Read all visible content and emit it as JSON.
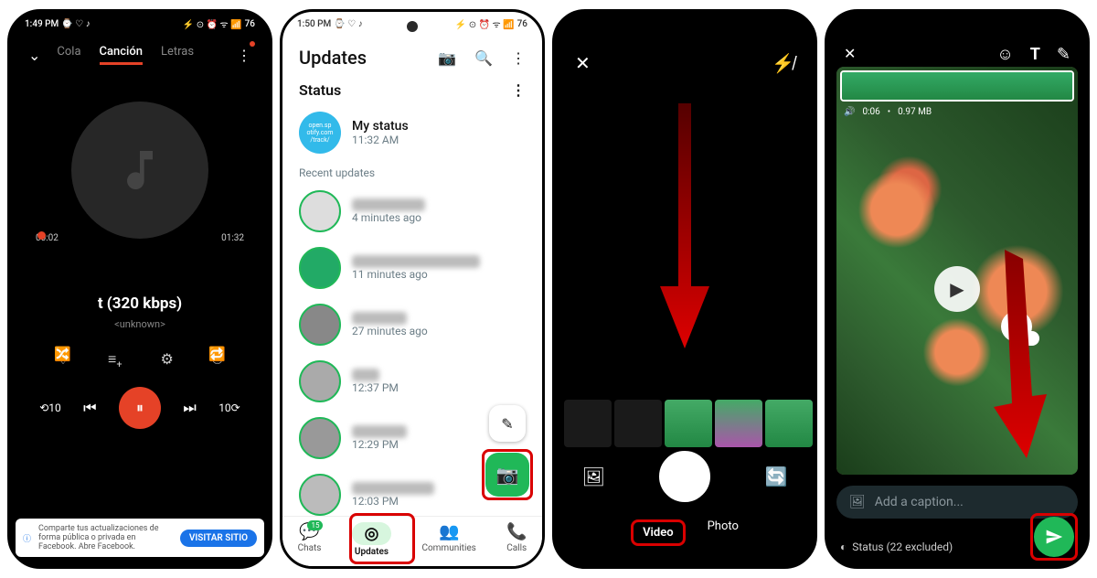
{
  "status": {
    "time1": "1:49 PM",
    "time2": "1:50 PM",
    "icons_left": "⌚ ♡ ♪ ♪",
    "icons_right": "⚡ ⊙ ⏰ ᯤ ▦ 📶",
    "battery": "76"
  },
  "phone1": {
    "tabs": {
      "queue": "Cola",
      "song": "Canción",
      "lyrics": "Letras"
    },
    "time_cur": "00:02",
    "time_total": "01:32",
    "title": "t (320 kbps)",
    "subtitle": "<unknown>",
    "banner_text": "Comparte tus actualizaciones de forma pública o privada en Facebook. Abre Facebook.",
    "banner_cta": "VISITAR SITIO"
  },
  "phone2": {
    "title": "Updates",
    "section_status": "Status",
    "my_status": "My status",
    "my_time": "11:32 AM",
    "recent": "Recent updates",
    "times": [
      "4 minutes ago",
      "11 minutes ago",
      "27 minutes ago",
      "12:37 PM",
      "12:29 PM",
      "12:03 PM"
    ],
    "nav": {
      "chats": "Chats",
      "updates": "Updates",
      "communities": "Communities",
      "calls": "Calls",
      "badge": "15"
    }
  },
  "phone3": {
    "mode_video": "Video",
    "mode_photo": "Photo"
  },
  "phone4": {
    "duration": "0:06",
    "size": "0.97 MB",
    "caption_placeholder": "Add a caption...",
    "status_text": "Status (22 excluded)"
  }
}
